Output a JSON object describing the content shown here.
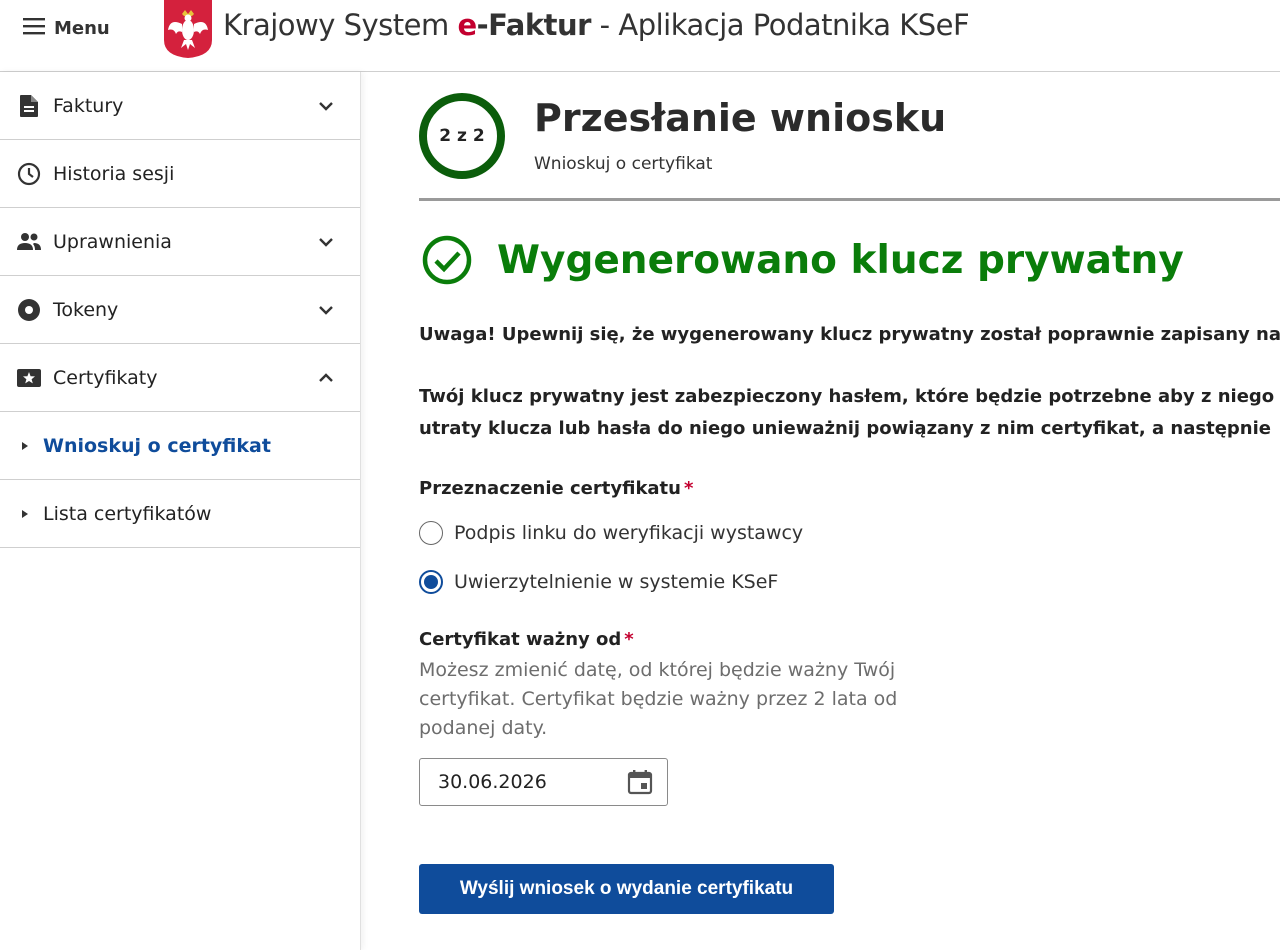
{
  "header": {
    "menu_label": "Menu",
    "title_prefix": "Krajowy System ",
    "title_e": "e",
    "title_faktur": "-Faktur",
    "title_suffix": " - Aplikacja Podatnika KSeF"
  },
  "sidebar": {
    "items": [
      {
        "label": "Faktury",
        "icon": "document-icon",
        "expandable": true,
        "expanded": false
      },
      {
        "label": "Historia sesji",
        "icon": "clock-icon",
        "expandable": false
      },
      {
        "label": "Uprawnienia",
        "icon": "people-icon",
        "expandable": true,
        "expanded": false
      },
      {
        "label": "Tokeny",
        "icon": "token-disc-icon",
        "expandable": true,
        "expanded": false
      },
      {
        "label": "Certyfikaty",
        "icon": "certificate-star-icon",
        "expandable": true,
        "expanded": true
      }
    ],
    "subitems": [
      {
        "label": "Wnioskuj o certyfikat",
        "active": true
      },
      {
        "label": "Lista certyfikatów",
        "active": false
      }
    ]
  },
  "step": {
    "indicator": "2 z 2",
    "title": "Przesłanie wniosku",
    "subtitle": "Wnioskuj o certyfikat"
  },
  "success": {
    "message": "Wygenerowano klucz prywatny"
  },
  "notices": {
    "warning": "Uwaga! Upewnij się, że wygenerowany klucz prywatny został poprawnie zapisany na",
    "info_line1": "Twój klucz prywatny jest zabezpieczony hasłem, które będzie potrzebne aby z niego",
    "info_line2": "utraty klucza lub hasła do niego unieważnij powiązany z nim certyfikat, a następnie"
  },
  "form": {
    "purpose_label": "Przeznaczenie certyfikatu",
    "required_mark": "*",
    "options": [
      {
        "label": "Podpis linku do weryfikacji wystawcy",
        "checked": false
      },
      {
        "label": "Uwierzytelnienie w systemie KSeF",
        "checked": true
      }
    ],
    "valid_from_label": "Certyfikat ważny od",
    "valid_from_hint": "Możesz zmienić datę, od której będzie ważny Twój certyfikat. Certyfikat będzie ważny przez 2 lata od podanej daty.",
    "valid_from_value": "30.06.2026",
    "submit_label": "Wyślij wniosek o wydanie certyfikatu"
  },
  "colors": {
    "primary": "#0f4c9b",
    "success": "#0a7d0a",
    "step_ring": "#0b5d0b",
    "required": "#c3002f"
  }
}
